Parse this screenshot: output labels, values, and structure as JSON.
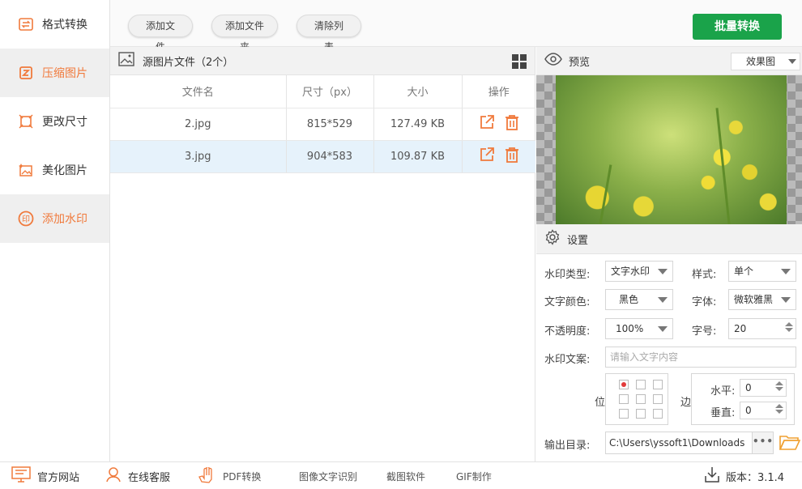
{
  "sidebar": {
    "items": [
      {
        "label": "格式转换",
        "icon": "swap-icon"
      },
      {
        "label": "压缩图片",
        "icon": "compress-icon"
      },
      {
        "label": "更改尺寸",
        "icon": "resize-icon"
      },
      {
        "label": "美化图片",
        "icon": "beautify-icon"
      },
      {
        "label": "添加水印",
        "icon": "stamp-icon"
      }
    ]
  },
  "toolbar": {
    "add_file": "添加文件",
    "add_folder": "添加文件夹",
    "clear_list": "清除列表",
    "batch_convert": "批量转换"
  },
  "file_panel": {
    "title": "源图片文件（2个）",
    "columns": [
      "文件名",
      "尺寸（px）",
      "大小",
      "操作"
    ],
    "rows": [
      {
        "name": "2.jpg",
        "size_px": "815*529",
        "size": "127.49 KB",
        "selected": false
      },
      {
        "name": "3.jpg",
        "size_px": "904*583",
        "size": "109.87 KB",
        "selected": true
      }
    ]
  },
  "preview": {
    "title": "预览",
    "mode": "效果图"
  },
  "settings": {
    "title": "设置",
    "watermark_type_label": "水印类型:",
    "watermark_type": "文字水印",
    "style_label": "样式:",
    "style": "单个",
    "text_color_label": "文字颜色:",
    "text_color": "黑色",
    "font_label": "字体:",
    "font": "微软雅黑",
    "opacity_label": "不透明度:",
    "opacity": "100%",
    "font_size_label": "字号:",
    "font_size": "20",
    "text_label": "水印文案:",
    "text_placeholder": "请输入文字内容",
    "position_label": "位置",
    "margin_label": "边距",
    "horizontal_label": "水平:",
    "horizontal": "0",
    "vertical_label": "垂直:",
    "vertical": "0",
    "output_label": "输出目录:",
    "output_path": "C:\\Users\\yssoft1\\Downloads",
    "browse": "•••"
  },
  "bottom": {
    "website": "官方网站",
    "support": "在线客服",
    "pdf": "PDF转换",
    "ocr": "图像文字识别",
    "screenshot": "截图软件",
    "gif": "GIF制作",
    "version": "版本：3.1.4"
  },
  "colors": {
    "accent": "#f07a3c",
    "primary_button": "#1aa34a",
    "selected_row": "#e6f2fb"
  }
}
